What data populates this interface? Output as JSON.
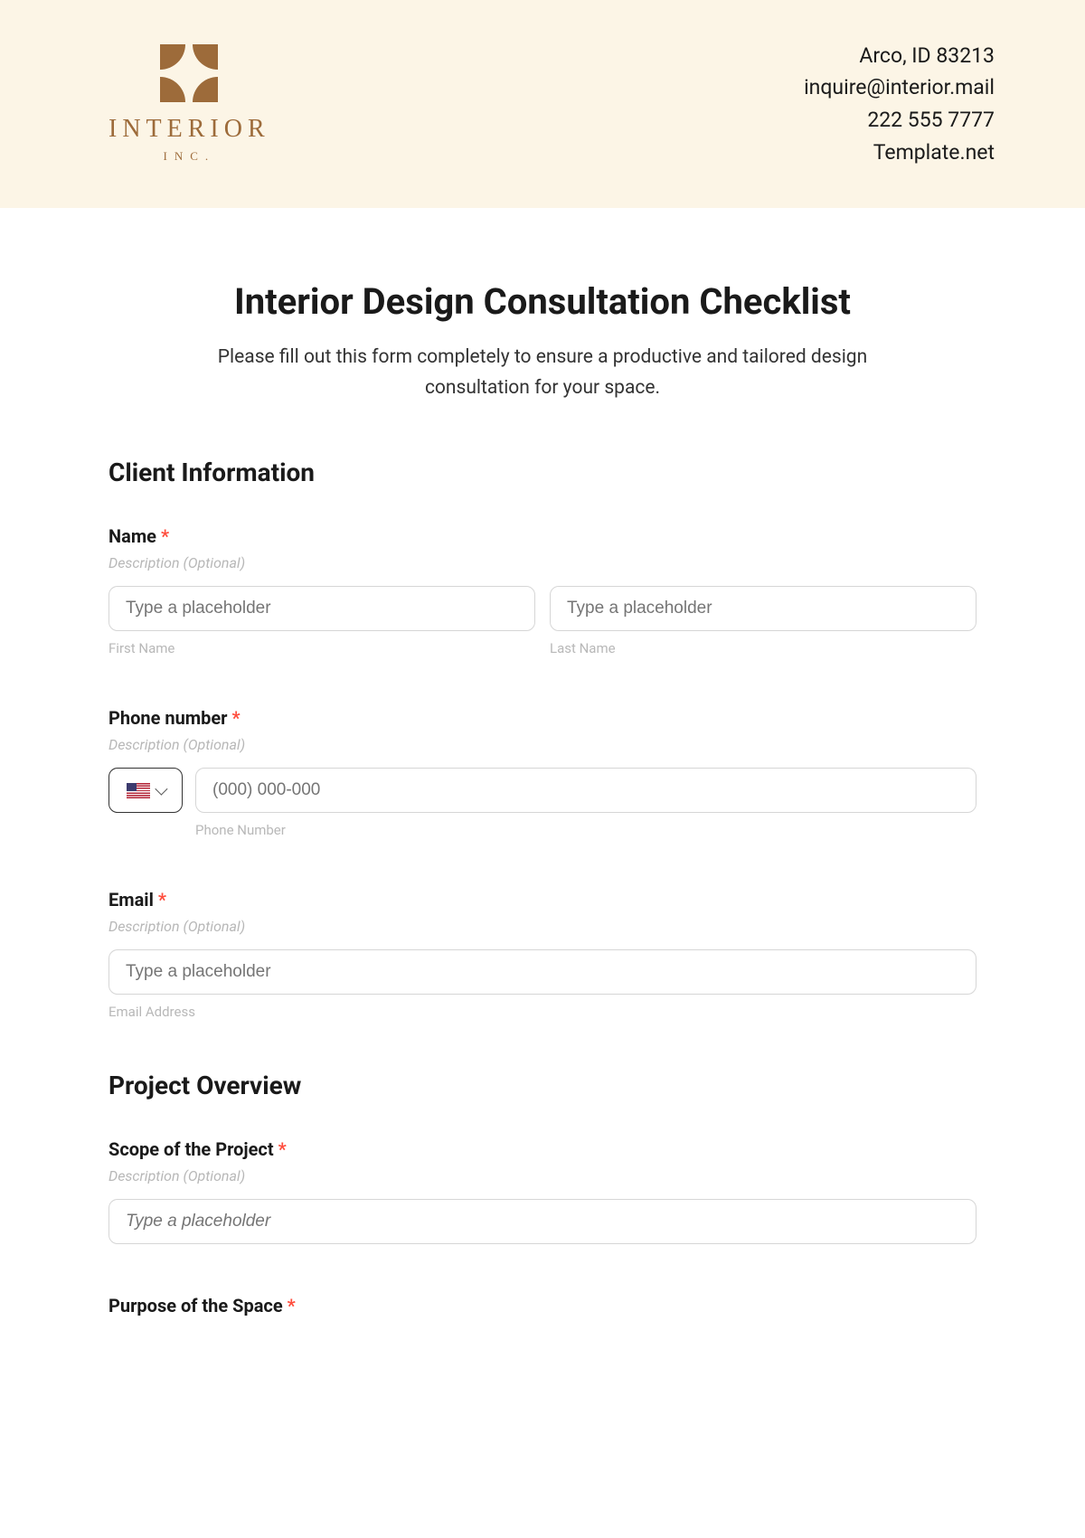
{
  "header": {
    "logo": {
      "name": "INTERIOR",
      "sub": "INC."
    },
    "contact": {
      "location": "Arco, ID 83213",
      "email": "inquire@interior.mail",
      "phone": "222 555 7777",
      "site": "Template.net"
    }
  },
  "form": {
    "title": "Interior Design Consultation Checklist",
    "subtitle": "Please fill out this form completely to ensure a productive and tailored design consultation for your space.",
    "sections": {
      "client_info": {
        "heading": "Client Information"
      },
      "project_overview": {
        "heading": "Project Overview"
      }
    },
    "fields": {
      "name": {
        "label": "Name",
        "desc": "Description (Optional)",
        "first_placeholder": "Type a placeholder",
        "first_sub": "First Name",
        "last_placeholder": "Type a placeholder",
        "last_sub": "Last Name"
      },
      "phone": {
        "label": "Phone number",
        "desc": "Description (Optional)",
        "placeholder": "(000) 000-000",
        "sub": "Phone Number"
      },
      "email": {
        "label": "Email",
        "desc": "Description (Optional)",
        "placeholder": "Type a placeholder",
        "sub": "Email Address"
      },
      "scope": {
        "label": "Scope of the Project",
        "desc": "Description (Optional)",
        "placeholder": "Type a placeholder"
      },
      "purpose": {
        "label": "Purpose of the Space"
      }
    }
  }
}
